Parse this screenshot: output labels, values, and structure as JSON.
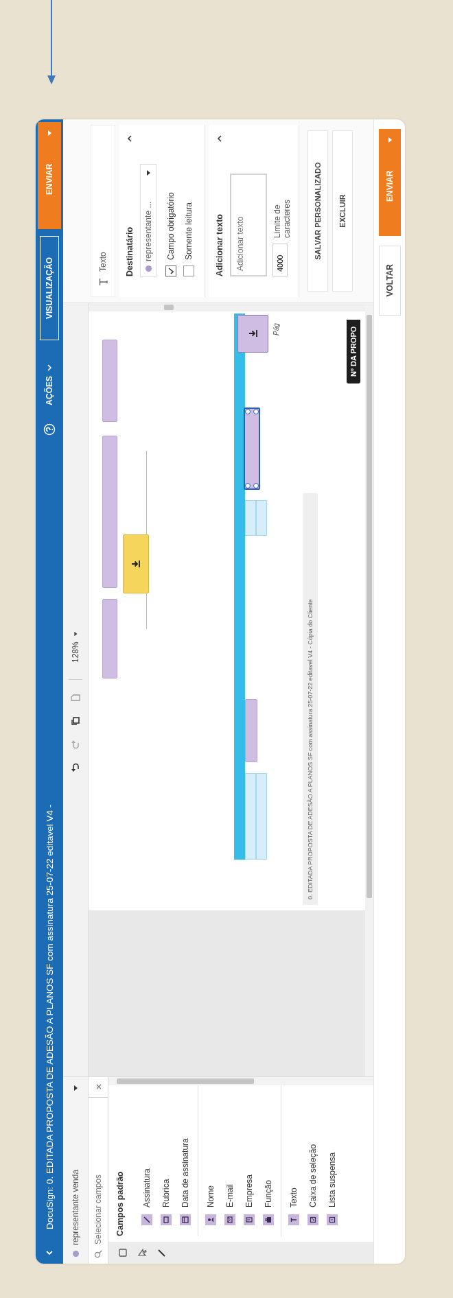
{
  "title_bar": {
    "title": "DocuSign: 0. EDITADA PROPOSTA DE ADESÃO A PLANOS SF com assinatura 25-07-22 editavel V4 -",
    "actions": "AÇÕES",
    "preview": "VISUALIZAÇÃO",
    "send": "ENVIAR"
  },
  "left_panel": {
    "recipient": "representante venda",
    "search": {
      "placeholder": "Selecionar campos"
    },
    "section_title": "Campos padrão",
    "groups": [
      [
        {
          "kind": "signature",
          "label": "Assinatura"
        },
        {
          "kind": "initials",
          "label": "Rubrica"
        },
        {
          "kind": "date",
          "label": "Data de assinatura"
        }
      ],
      [
        {
          "kind": "name",
          "label": "Nome"
        },
        {
          "kind": "email",
          "label": "E-mail"
        },
        {
          "kind": "company",
          "label": "Empresa"
        },
        {
          "kind": "role",
          "label": "Função"
        }
      ],
      [
        {
          "kind": "text",
          "label": "Texto"
        },
        {
          "kind": "checkbox",
          "label": "Caixa de seleção"
        },
        {
          "kind": "dropdown",
          "label": "Lista suspensa"
        }
      ]
    ]
  },
  "toolbar": {
    "zoom": "128%"
  },
  "document": {
    "fields": [
      {
        "kind": "text",
        "selected": false
      },
      {
        "kind": "text",
        "selected": false
      },
      {
        "kind": "text",
        "selected": false
      },
      {
        "kind": "signature",
        "selected": false
      },
      {
        "kind": "text",
        "selected": false
      },
      {
        "kind": "text",
        "selected": true
      },
      {
        "kind": "attachment",
        "selected": false
      }
    ],
    "page_label": "Pág",
    "footer": "0. EDITADA PROPOSTA DE ADESÃO A PLANOS SF com assinatura 25-07-22 editavel V4 - Cópia do Cliente",
    "proposal_label": "Nº DA PROPO"
  },
  "right_panel": {
    "field_type": "Texto",
    "recipient_section": {
      "title": "Destinatário",
      "expanded": true,
      "recipient": "representante ...",
      "options": [
        {
          "label": "Campo obrigatório",
          "checked": true
        },
        {
          "label": "Somente leitura",
          "checked": false
        }
      ]
    },
    "text_section": {
      "title": "Adicionar texto",
      "expanded": true,
      "placeholder": "Adicionar texto",
      "limit": "4000",
      "limit_label": "Limite de caracteres"
    },
    "buttons": [
      "SALVAR PERSONALIZADO",
      "EXCLUIR"
    ]
  },
  "footer": {
    "buttons": [
      {
        "kind": "secondary",
        "label": "VOLTAR"
      },
      {
        "kind": "primary",
        "label": "ENVIAR"
      }
    ]
  }
}
